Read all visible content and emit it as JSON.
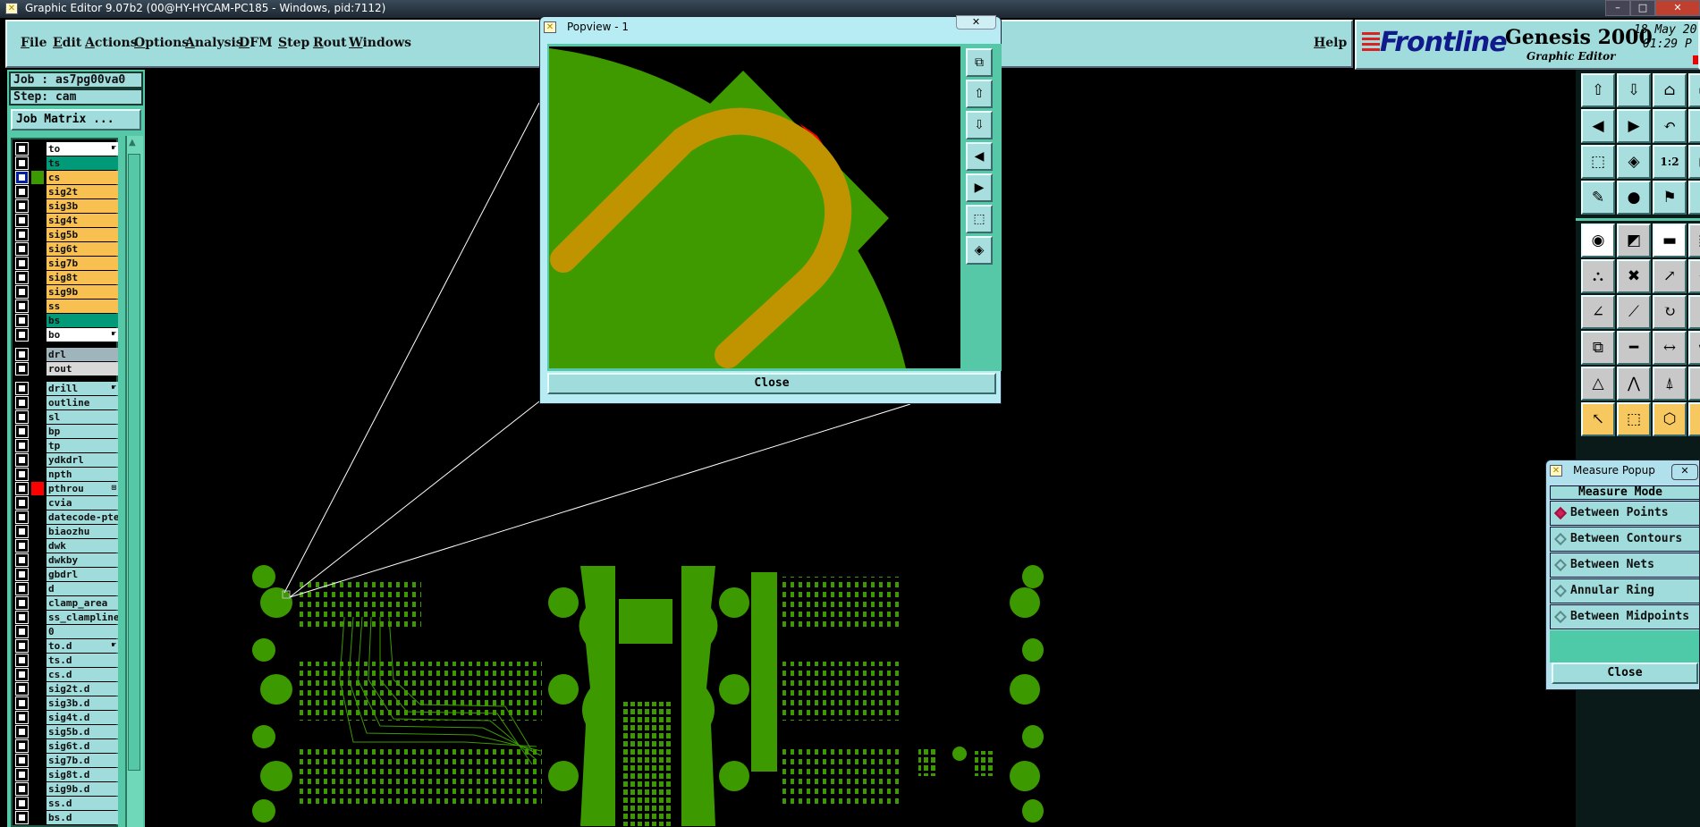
{
  "window": {
    "title": "Graphic Editor 9.07b2 (00@HY-HYCAM-PC185 - Windows, pid:7112)"
  },
  "menu": [
    "File",
    "Edit",
    "Actions",
    "Options",
    "Analysis",
    "DFM",
    "Step",
    "Rout",
    "Windows"
  ],
  "help": "Help",
  "brand": {
    "logo": "Frontline",
    "product": "Genesis 2000",
    "subtitle": "Graphic Editor",
    "date": "18 May 20",
    "time": "01:29 P"
  },
  "job": {
    "job_label": "Job : as7pg00va0",
    "step_label": "Step: cam",
    "matrix_button": "Job Matrix ..."
  },
  "layers": [
    {
      "name": "to",
      "bg": "#ffffff",
      "hand": true
    },
    {
      "name": "ts",
      "bg": "#009a78"
    },
    {
      "name": "cs",
      "bg": "#f8c050",
      "color": "#3c9a00",
      "selected": true
    },
    {
      "name": "sig2t",
      "bg": "#f8c050"
    },
    {
      "name": "sig3b",
      "bg": "#f8c050"
    },
    {
      "name": "sig4t",
      "bg": "#f8c050"
    },
    {
      "name": "sig5b",
      "bg": "#f8c050"
    },
    {
      "name": "sig6t",
      "bg": "#f8c050"
    },
    {
      "name": "sig7b",
      "bg": "#f8c050"
    },
    {
      "name": "sig8t",
      "bg": "#f8c050"
    },
    {
      "name": "sig9b",
      "bg": "#f8c050"
    },
    {
      "name": "ss",
      "bg": "#f8c050"
    },
    {
      "name": "bs",
      "bg": "#009a78"
    },
    {
      "name": "bo",
      "bg": "#ffffff",
      "hand": true
    },
    {
      "name": "drl",
      "bg": "#a0b4bc",
      "gap": true
    },
    {
      "name": "rout",
      "bg": "#d8d8d8"
    },
    {
      "name": "drill",
      "bg": "#a0dcdc",
      "hand": true,
      "gap": true
    },
    {
      "name": "outline",
      "bg": "#a0dcdc"
    },
    {
      "name": "sl",
      "bg": "#a0dcdc"
    },
    {
      "name": "bp",
      "bg": "#a0dcdc"
    },
    {
      "name": "tp",
      "bg": "#a0dcdc"
    },
    {
      "name": "ydkdrl",
      "bg": "#a0dcdc"
    },
    {
      "name": "npth",
      "bg": "#a0dcdc"
    },
    {
      "name": "pthrou",
      "bg": "#a0dcdc",
      "color": "#ff0000",
      "mark": "⊞"
    },
    {
      "name": "cvia",
      "bg": "#a0dcdc"
    },
    {
      "name": "datecode-pte",
      "bg": "#a0dcdc"
    },
    {
      "name": "biaozhu",
      "bg": "#a0dcdc"
    },
    {
      "name": "dwk",
      "bg": "#a0dcdc"
    },
    {
      "name": "dwkby",
      "bg": "#a0dcdc"
    },
    {
      "name": "gbdrl",
      "bg": "#a0dcdc"
    },
    {
      "name": "d",
      "bg": "#a0dcdc"
    },
    {
      "name": "clamp_area",
      "bg": "#a0dcdc"
    },
    {
      "name": "ss_clampline",
      "bg": "#a0dcdc"
    },
    {
      "name": "0",
      "bg": "#a0dcdc"
    },
    {
      "name": "to.d",
      "bg": "#a0dcdc",
      "hand": true
    },
    {
      "name": "ts.d",
      "bg": "#a0dcdc"
    },
    {
      "name": "cs.d",
      "bg": "#a0dcdc"
    },
    {
      "name": "sig2t.d",
      "bg": "#a0dcdc"
    },
    {
      "name": "sig3b.d",
      "bg": "#a0dcdc"
    },
    {
      "name": "sig4t.d",
      "bg": "#a0dcdc"
    },
    {
      "name": "sig5b.d",
      "bg": "#a0dcdc"
    },
    {
      "name": "sig6t.d",
      "bg": "#a0dcdc"
    },
    {
      "name": "sig7b.d",
      "bg": "#a0dcdc"
    },
    {
      "name": "sig8t.d",
      "bg": "#a0dcdc"
    },
    {
      "name": "sig9b.d",
      "bg": "#a0dcdc"
    },
    {
      "name": "ss.d",
      "bg": "#a0dcdc"
    },
    {
      "name": "bs.d",
      "bg": "#a0dcdc"
    }
  ],
  "toolbar": [
    [
      "layer-up",
      "layer-down",
      "home",
      "window"
    ],
    [
      "pan-left",
      "pan-right",
      "undo-view",
      "redo-view"
    ],
    [
      "zoom-fit",
      "zoom-center",
      "1:2",
      "zoom-box"
    ],
    [
      "snap-settings",
      "net-select",
      "drc-tool",
      "net-tool"
    ],
    [
      "features-select",
      "polygon-tool",
      "ruler",
      "box-select"
    ],
    [
      "connect-pads",
      "delete-feature",
      "move-pad",
      "spacing"
    ],
    [
      "angle-line",
      "diagonal-line",
      "rotate",
      "align"
    ],
    [
      "pad-offset",
      "line-center",
      "dimension",
      "shape"
    ],
    [
      "triangle-a",
      "triangle-b",
      "triangle-c",
      "triangle-d"
    ],
    [
      "select-arrow",
      "select-box",
      "select-poly",
      "probe"
    ]
  ],
  "toolbar_labels": {
    "ratio": "1:2"
  },
  "popview": {
    "title": "Popview - 1",
    "close": "Close"
  },
  "measure": {
    "title": "Measure Popup",
    "mode_header": "Measure Mode",
    "options": [
      "Between Points",
      "Between Contours",
      "Between Nets",
      "Annular Ring",
      "Between Midpoints"
    ],
    "selected": 0,
    "close": "Close"
  },
  "colors": {
    "panel": "#a0dcdc",
    "copper": "#3c9a00",
    "trace": "#c09400",
    "accent_red": "#ff0000"
  }
}
